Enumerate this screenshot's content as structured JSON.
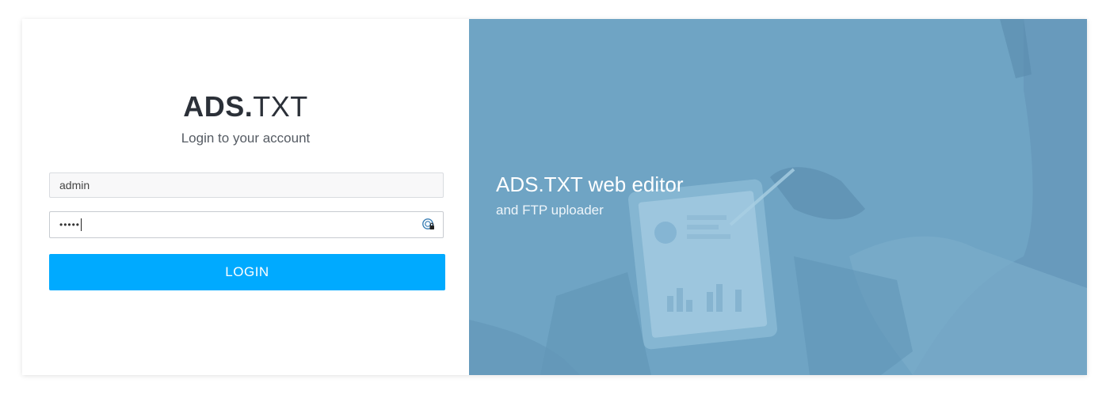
{
  "brand": {
    "bold": "ADS.",
    "light": "TXT"
  },
  "subtitle": "Login to your account",
  "form": {
    "username_value": "admin",
    "password_mask": "•••••",
    "login_label": "LOGIN"
  },
  "hero": {
    "title": "ADS.TXT web editor",
    "subtitle": "and FTP uploader"
  },
  "colors": {
    "accent": "#00aaff",
    "hero_overlay": "#6ea3c3",
    "brand_text": "#2b3038"
  },
  "icons": [
    "password-manager-key-icon"
  ]
}
